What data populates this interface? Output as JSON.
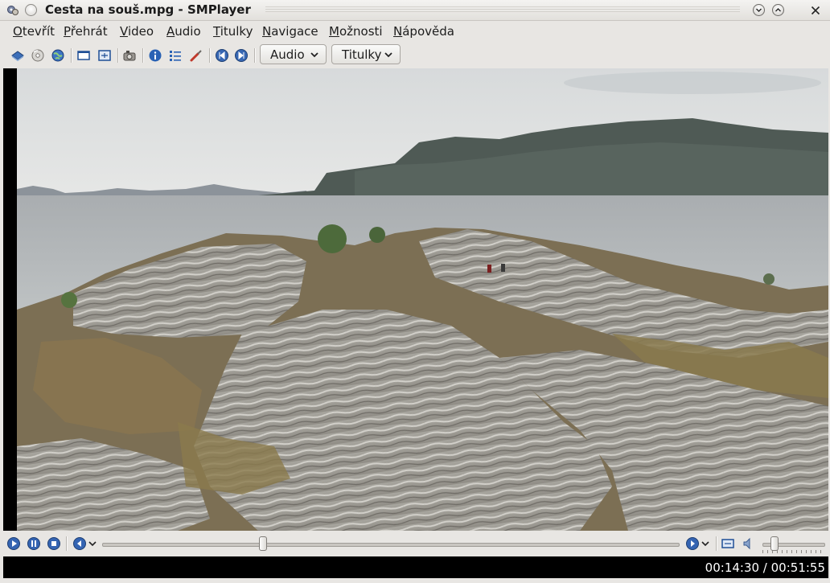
{
  "window": {
    "title": "Cesta na souš.mpg - SMPlayer"
  },
  "menu": {
    "items": [
      {
        "label": "Otevřít",
        "accel": "O",
        "rest": "tevřít"
      },
      {
        "label": "Přehrát",
        "accel": "P",
        "rest": "řehrát"
      },
      {
        "label": "Video",
        "accel": "V",
        "rest": "ideo"
      },
      {
        "label": "Audio",
        "accel": "A",
        "rest": "udio"
      },
      {
        "label": "Titulky",
        "accel": "T",
        "rest": "itulky"
      },
      {
        "label": "Navigace",
        "accel": "N",
        "rest": "avigace"
      },
      {
        "label": "Možnosti",
        "accel": "M",
        "rest": "ožnosti"
      },
      {
        "label": "Nápověda",
        "accel": "N",
        "rest": "ápověda"
      }
    ]
  },
  "toolbar": {
    "icons": [
      "open-file-icon",
      "open-disc-icon",
      "open-url-icon",
      "compact-mode-icon",
      "fullscreen-icon",
      "screenshot-icon",
      "info-icon",
      "playlist-icon",
      "preferences-icon",
      "previous-icon",
      "next-icon"
    ],
    "audio_label": "Audio",
    "subtitles_label": "Titulky"
  },
  "video": {
    "content": "landscape-rocky-coast"
  },
  "controls": {
    "icons": [
      "play-icon",
      "pause-icon",
      "stop-icon",
      "rewind-menu-icon",
      "forward-menu-icon",
      "fullscreen-toggle-icon",
      "volume-icon"
    ],
    "seek_fraction": 0.28,
    "volume_fraction": 0.2
  },
  "status": {
    "time": "00:14:30 / 00:51:55"
  },
  "colors": {
    "window_bg": "#e8e6e3",
    "status_bg": "#000000",
    "accent_blue": "#2f5fa8"
  }
}
